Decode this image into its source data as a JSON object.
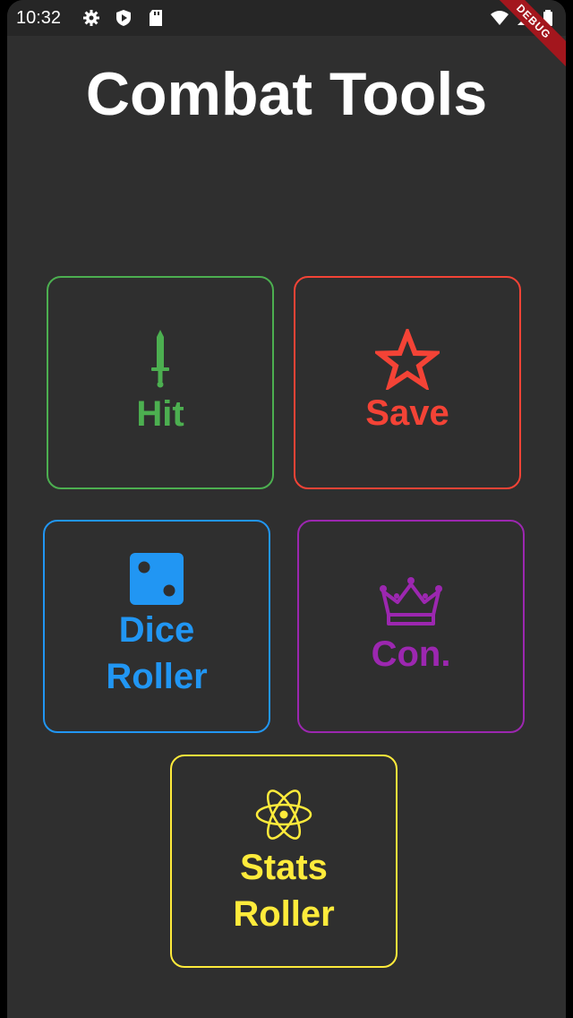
{
  "status_bar": {
    "time": "10:32",
    "icons": [
      "gear-icon",
      "shield-play-icon",
      "sd-card-icon",
      "wifi-icon",
      "signal-icon",
      "battery-icon"
    ],
    "debug_banner": "DEBUG"
  },
  "page": {
    "title": "Combat Tools"
  },
  "tiles": [
    {
      "label": "Hit",
      "icon": "sword-icon",
      "color": "#4caf50"
    },
    {
      "label": "Save",
      "icon": "star-icon",
      "color": "#f44336"
    },
    {
      "label": "Dice\nRoller",
      "icon": "dice-icon",
      "color": "#2196f3"
    },
    {
      "label": "Con.",
      "icon": "crown-icon",
      "color": "#9c27b0"
    },
    {
      "label": "Stats\nRoller",
      "icon": "atom-icon",
      "color": "#ffeb3b"
    }
  ]
}
